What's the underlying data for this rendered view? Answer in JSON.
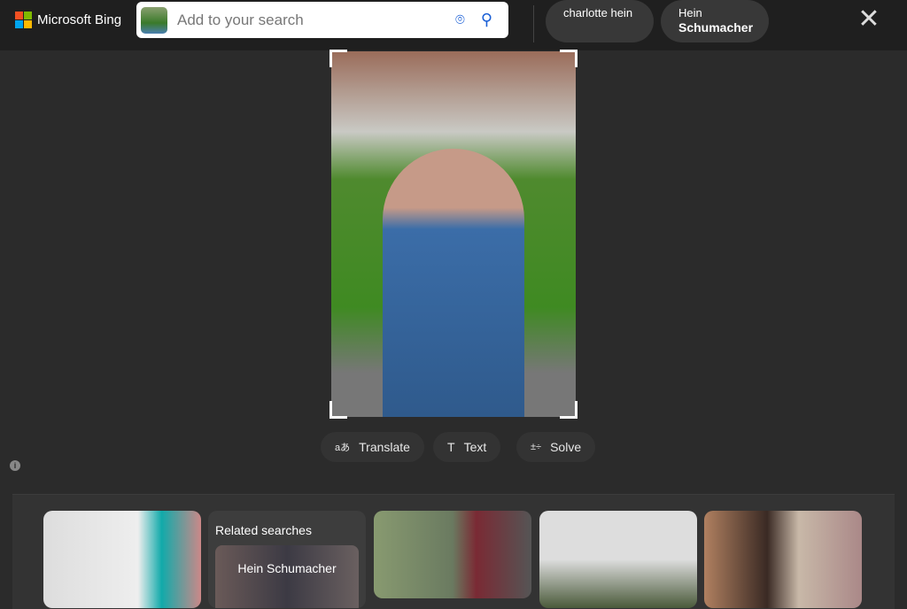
{
  "header": {
    "brand": "Microsoft Bing",
    "search_placeholder": "Add to your search",
    "chips": [
      {
        "line1": "charlotte hein",
        "line2": ""
      },
      {
        "line1": "Hein",
        "line2": "Schumacher"
      }
    ]
  },
  "tools": [
    {
      "icon": "aあ",
      "label": "Translate"
    },
    {
      "icon": "T",
      "label": "Text"
    },
    {
      "icon": "±÷",
      "label": "Solve"
    }
  ],
  "related": {
    "title": "Related searches",
    "items": [
      "Hein Schumacher"
    ]
  }
}
